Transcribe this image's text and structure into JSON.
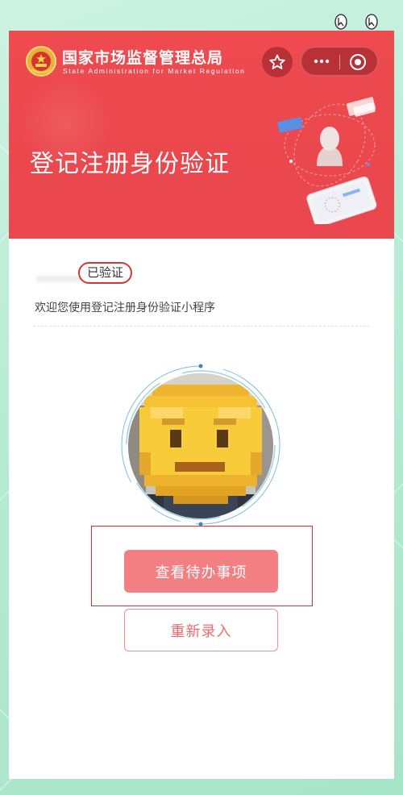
{
  "header": {
    "agency_name": "国家市场监督管理总局",
    "agency_subtitle": "State Administration for Market Regulation",
    "emblem_icon": "national-emblem-icon",
    "favorite_icon": "star-outline-icon",
    "capsule": {
      "more_icon": "more-dots-icon",
      "close_icon": "miniprogram-close-icon"
    }
  },
  "banner": {
    "title": "登记注册身份验证",
    "illustration_icon": "face-scan-phone-illustration",
    "background_color": "#e9474e"
  },
  "user": {
    "verified_badge": "已验证",
    "welcome_text": "欢迎您使用登记注册身份验证小程序"
  },
  "face": {
    "photo_icon": "pixelated-face-photo",
    "ring_color": "#5ba6c8"
  },
  "actions": {
    "view_pending_label": "查看待办事项",
    "re_enter_label": "重新录入",
    "accent_color": "#f28083"
  },
  "cursors": [
    "cursor-icon",
    "cursor-icon"
  ]
}
